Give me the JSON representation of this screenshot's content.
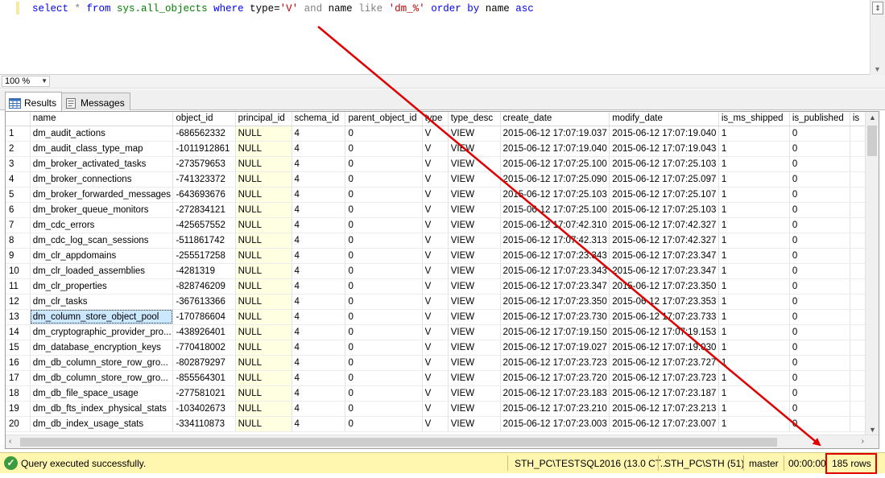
{
  "editor": {
    "query_tokens": [
      {
        "t": "select",
        "c": "kw"
      },
      {
        "t": " * ",
        "c": "gray"
      },
      {
        "t": "from",
        "c": "kw"
      },
      {
        "t": " sys.all_objects ",
        "c": "sys"
      },
      {
        "t": "where",
        "c": "kw"
      },
      {
        "t": " type=",
        "c": "plain"
      },
      {
        "t": "'V'",
        "c": "str"
      },
      {
        "t": " and ",
        "c": "gray"
      },
      {
        "t": "name",
        "c": "plain"
      },
      {
        "t": " like ",
        "c": "gray"
      },
      {
        "t": "'dm_%'",
        "c": "str"
      },
      {
        "t": " order by",
        "c": "kw"
      },
      {
        "t": " name",
        "c": "plain"
      },
      {
        "t": " asc",
        "c": "kw"
      }
    ]
  },
  "zoom": {
    "value": "100 %"
  },
  "tabs": {
    "results": "Results",
    "messages": "Messages"
  },
  "grid": {
    "columns": [
      "name",
      "object_id",
      "principal_id",
      "schema_id",
      "parent_object_id",
      "type",
      "type_desc",
      "create_date",
      "modify_date",
      "is_ms_shipped",
      "is_published",
      "is"
    ],
    "rows": [
      [
        "1",
        "dm_audit_actions",
        "-686562332",
        "NULL",
        "4",
        "0",
        "V",
        "VIEW",
        "2015-06-12 17:07:19.037",
        "2015-06-12 17:07:19.040",
        "1",
        "0"
      ],
      [
        "2",
        "dm_audit_class_type_map",
        "-1011912861",
        "NULL",
        "4",
        "0",
        "V",
        "VIEW",
        "2015-06-12 17:07:19.040",
        "2015-06-12 17:07:19.043",
        "1",
        "0"
      ],
      [
        "3",
        "dm_broker_activated_tasks",
        "-273579653",
        "NULL",
        "4",
        "0",
        "V",
        "VIEW",
        "2015-06-12 17:07:25.100",
        "2015-06-12 17:07:25.103",
        "1",
        "0"
      ],
      [
        "4",
        "dm_broker_connections",
        "-741323372",
        "NULL",
        "4",
        "0",
        "V",
        "VIEW",
        "2015-06-12 17:07:25.090",
        "2015-06-12 17:07:25.097",
        "1",
        "0"
      ],
      [
        "5",
        "dm_broker_forwarded_messages",
        "-643693676",
        "NULL",
        "4",
        "0",
        "V",
        "VIEW",
        "2015-06-12 17:07:25.103",
        "2015-06-12 17:07:25.107",
        "1",
        "0"
      ],
      [
        "6",
        "dm_broker_queue_monitors",
        "-272834121",
        "NULL",
        "4",
        "0",
        "V",
        "VIEW",
        "2015-06-12 17:07:25.100",
        "2015-06-12 17:07:25.103",
        "1",
        "0"
      ],
      [
        "7",
        "dm_cdc_errors",
        "-425657552",
        "NULL",
        "4",
        "0",
        "V",
        "VIEW",
        "2015-06-12 17:07:42.310",
        "2015-06-12 17:07:42.327",
        "1",
        "0"
      ],
      [
        "8",
        "dm_cdc_log_scan_sessions",
        "-511861742",
        "NULL",
        "4",
        "0",
        "V",
        "VIEW",
        "2015-06-12 17:07:42.313",
        "2015-06-12 17:07:42.327",
        "1",
        "0"
      ],
      [
        "9",
        "dm_clr_appdomains",
        "-255517258",
        "NULL",
        "4",
        "0",
        "V",
        "VIEW",
        "2015-06-12 17:07:23.343",
        "2015-06-12 17:07:23.347",
        "1",
        "0"
      ],
      [
        "10",
        "dm_clr_loaded_assemblies",
        "-4281319",
        "NULL",
        "4",
        "0",
        "V",
        "VIEW",
        "2015-06-12 17:07:23.343",
        "2015-06-12 17:07:23.347",
        "1",
        "0"
      ],
      [
        "11",
        "dm_clr_properties",
        "-828746209",
        "NULL",
        "4",
        "0",
        "V",
        "VIEW",
        "2015-06-12 17:07:23.347",
        "2015-06-12 17:07:23.350",
        "1",
        "0"
      ],
      [
        "12",
        "dm_clr_tasks",
        "-367613366",
        "NULL",
        "4",
        "0",
        "V",
        "VIEW",
        "2015-06-12 17:07:23.350",
        "2015-06-12 17:07:23.353",
        "1",
        "0"
      ],
      [
        "13",
        "dm_column_store_object_pool",
        "-170786604",
        "NULL",
        "4",
        "0",
        "V",
        "VIEW",
        "2015-06-12 17:07:23.730",
        "2015-06-12 17:07:23.733",
        "1",
        "0"
      ],
      [
        "14",
        "dm_cryptographic_provider_pro...",
        "-438926401",
        "NULL",
        "4",
        "0",
        "V",
        "VIEW",
        "2015-06-12 17:07:19.150",
        "2015-06-12 17:07:19.153",
        "1",
        "0"
      ],
      [
        "15",
        "dm_database_encryption_keys",
        "-770418002",
        "NULL",
        "4",
        "0",
        "V",
        "VIEW",
        "2015-06-12 17:07:19.027",
        "2015-06-12 17:07:19.030",
        "1",
        "0"
      ],
      [
        "16",
        "dm_db_column_store_row_gro...",
        "-802879297",
        "NULL",
        "4",
        "0",
        "V",
        "VIEW",
        "2015-06-12 17:07:23.723",
        "2015-06-12 17:07:23.727",
        "1",
        "0"
      ],
      [
        "17",
        "dm_db_column_store_row_gro...",
        "-855564301",
        "NULL",
        "4",
        "0",
        "V",
        "VIEW",
        "2015-06-12 17:07:23.720",
        "2015-06-12 17:07:23.723",
        "1",
        "0"
      ],
      [
        "18",
        "dm_db_file_space_usage",
        "-277581021",
        "NULL",
        "4",
        "0",
        "V",
        "VIEW",
        "2015-06-12 17:07:23.183",
        "2015-06-12 17:07:23.187",
        "1",
        "0"
      ],
      [
        "19",
        "dm_db_fts_index_physical_stats",
        "-103402673",
        "NULL",
        "4",
        "0",
        "V",
        "VIEW",
        "2015-06-12 17:07:23.210",
        "2015-06-12 17:07:23.213",
        "1",
        "0"
      ],
      [
        "20",
        "dm_db_index_usage_stats",
        "-334110873",
        "NULL",
        "4",
        "0",
        "V",
        "VIEW",
        "2015-06-12 17:07:23.003",
        "2015-06-12 17:07:23.007",
        "1",
        "0"
      ]
    ],
    "selected_row": 13
  },
  "status": {
    "message": "Query executed successfully.",
    "server": "STH_PC\\TESTSQL2016 (13.0 CT...",
    "user": "STH_PC\\STH (51)",
    "database": "master",
    "elapsed": "00:00:00",
    "rows": "185 rows"
  },
  "colors": {
    "annotation_red": "#e00000",
    "status_bg": "#fff6b0",
    "null_bg": "#ffffe1",
    "selection": "#cce8ff"
  }
}
